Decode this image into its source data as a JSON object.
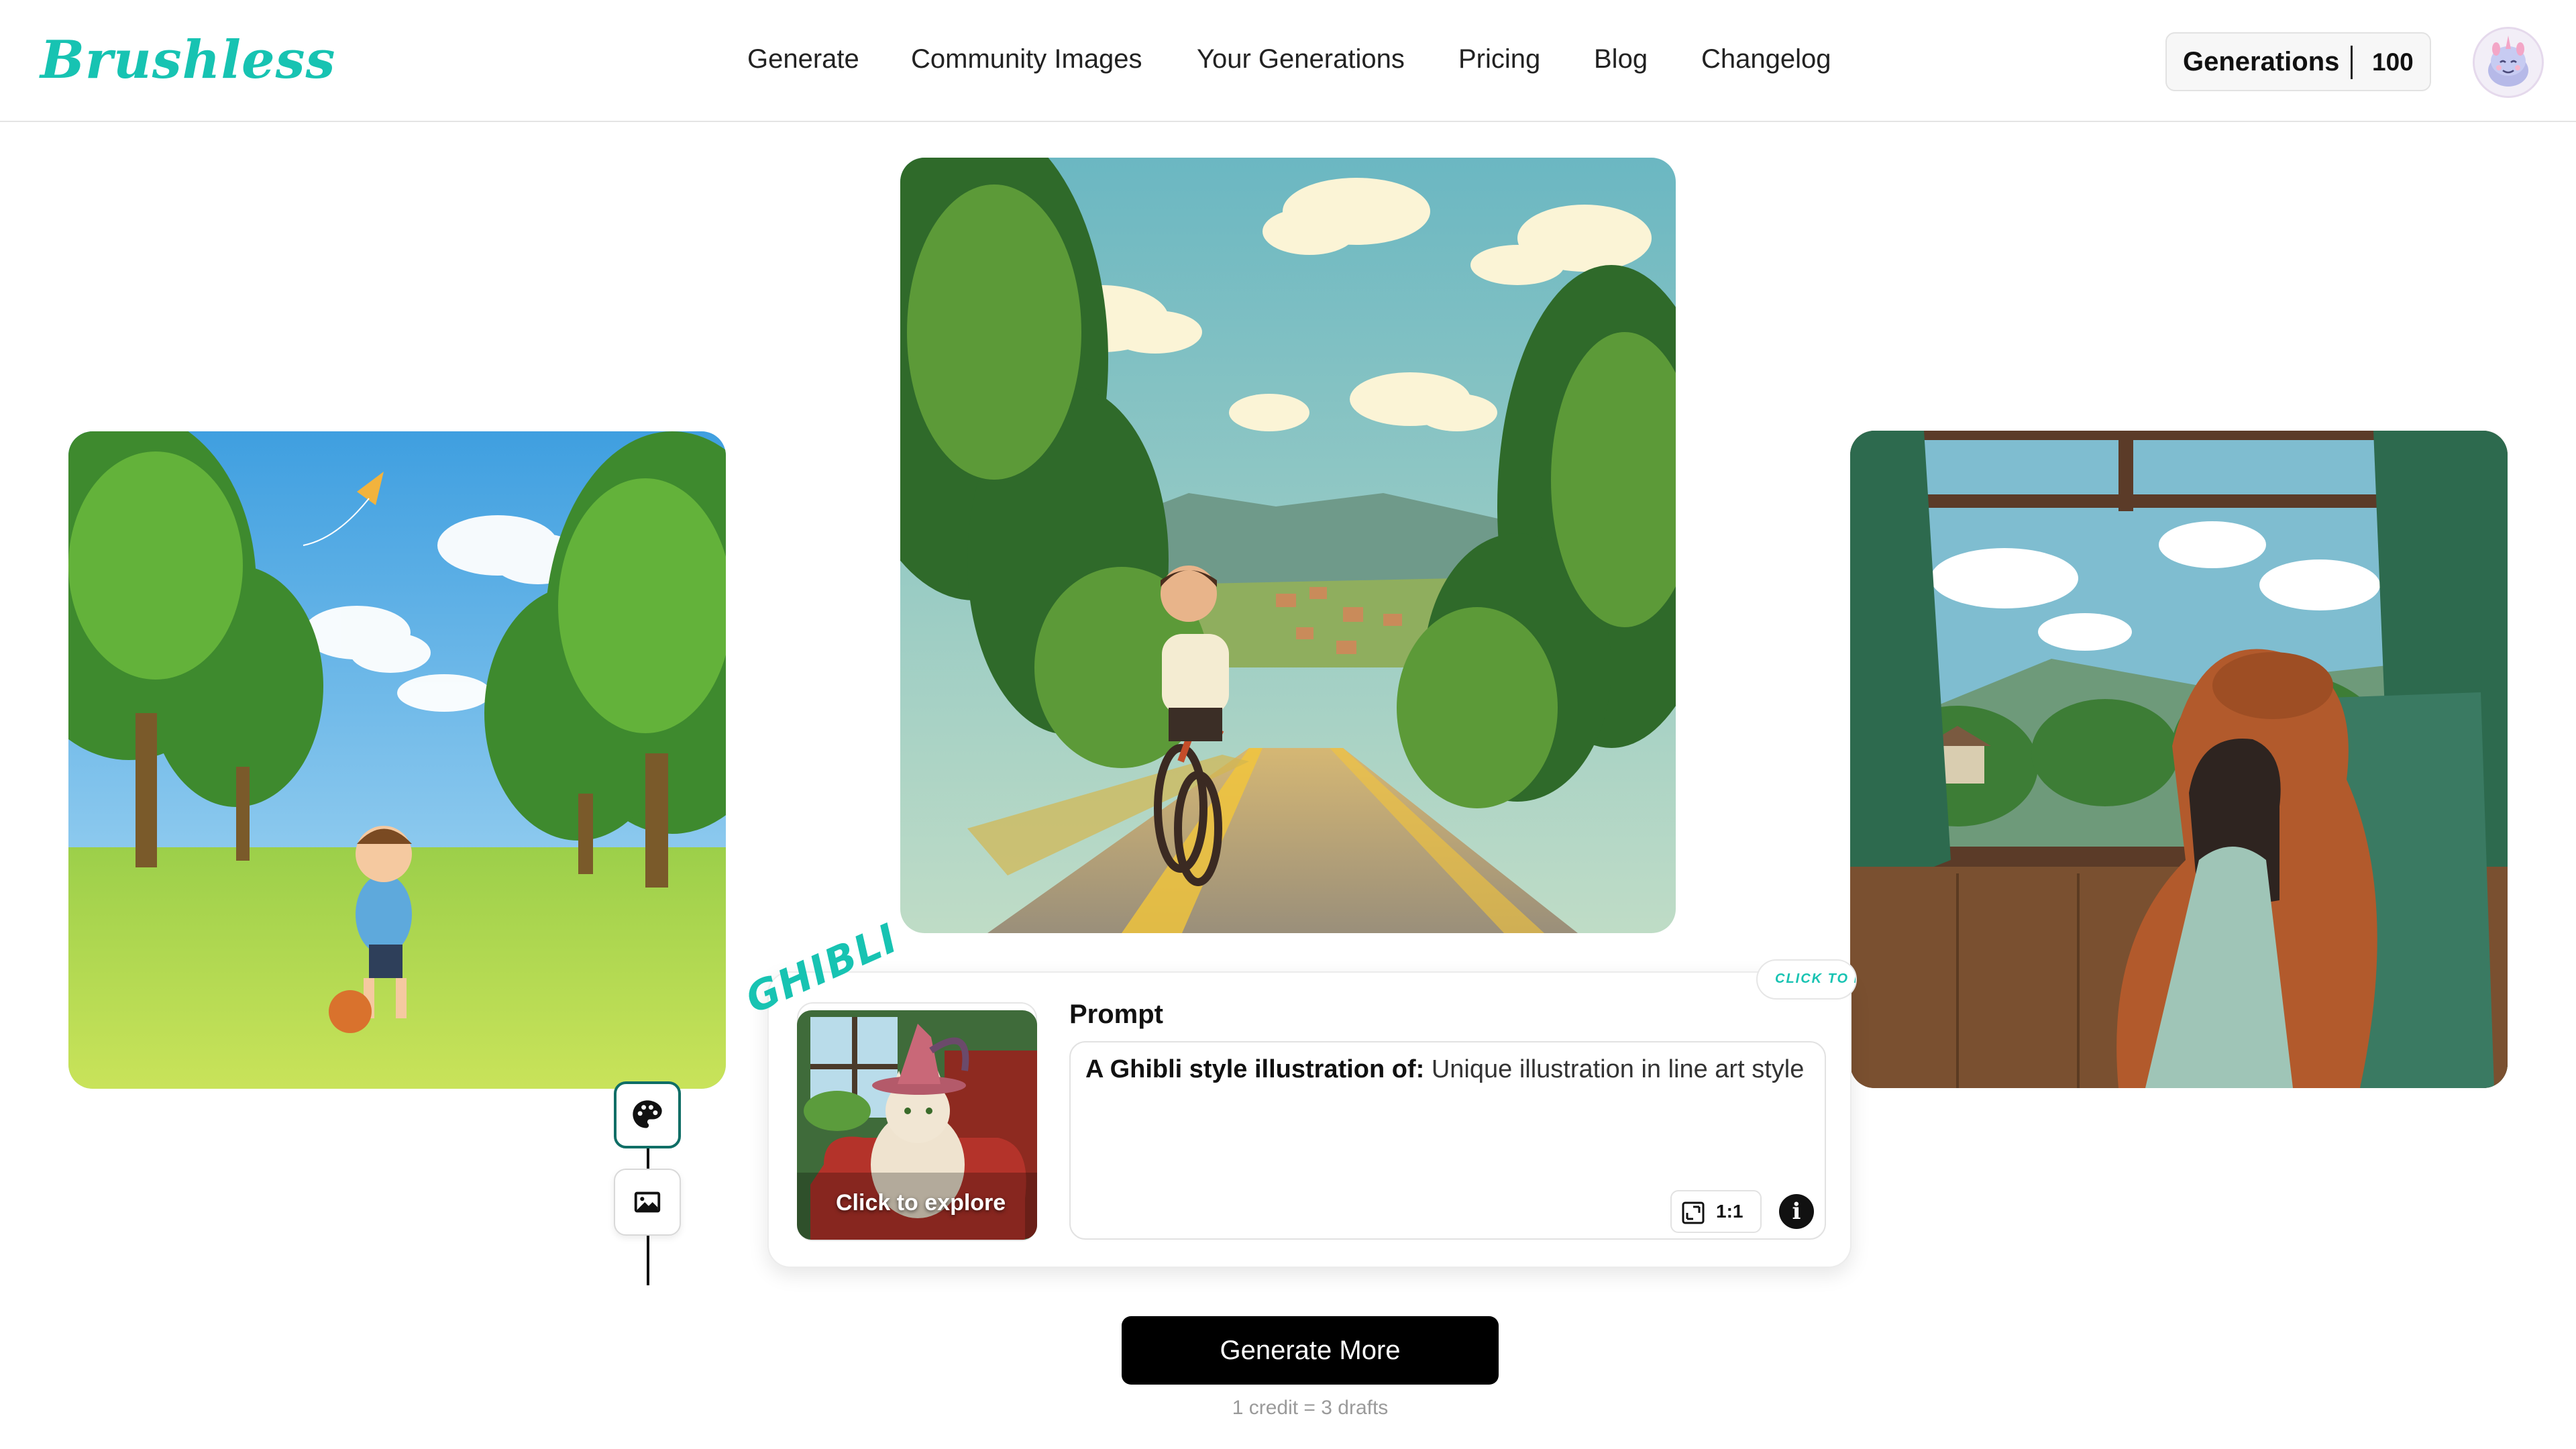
{
  "header": {
    "logo": "Brushless",
    "nav": [
      {
        "label": "Generate"
      },
      {
        "label": "Community Images"
      },
      {
        "label": "Your Generations"
      },
      {
        "label": "Pricing"
      },
      {
        "label": "Blog"
      },
      {
        "label": "Changelog"
      }
    ],
    "generations": {
      "label": "Generations",
      "count": "100"
    }
  },
  "gallery": {
    "left_icon": "kite-park-illustration",
    "center_icon": "bike-road-illustration",
    "right_icon": "train-window-illustration"
  },
  "tools": {
    "palette_icon": "palette-icon",
    "image_icon": "image-icon"
  },
  "prompt_panel": {
    "style_tag": "GHIBLI",
    "click_pill": "CLICK TO EX",
    "thumbnail_caption": "Click to explore",
    "prompt_label": "Prompt",
    "prompt_prefix": "A Ghibli style illustration of:",
    "prompt_value": " Unique illustration in line art style",
    "ratio": "1:1",
    "info_icon": "i"
  },
  "footer": {
    "generate_button": "Generate More",
    "credit_note": "1 credit = 3 drafts"
  },
  "colors": {
    "accent": "#17c3b2",
    "button": "#000000"
  }
}
